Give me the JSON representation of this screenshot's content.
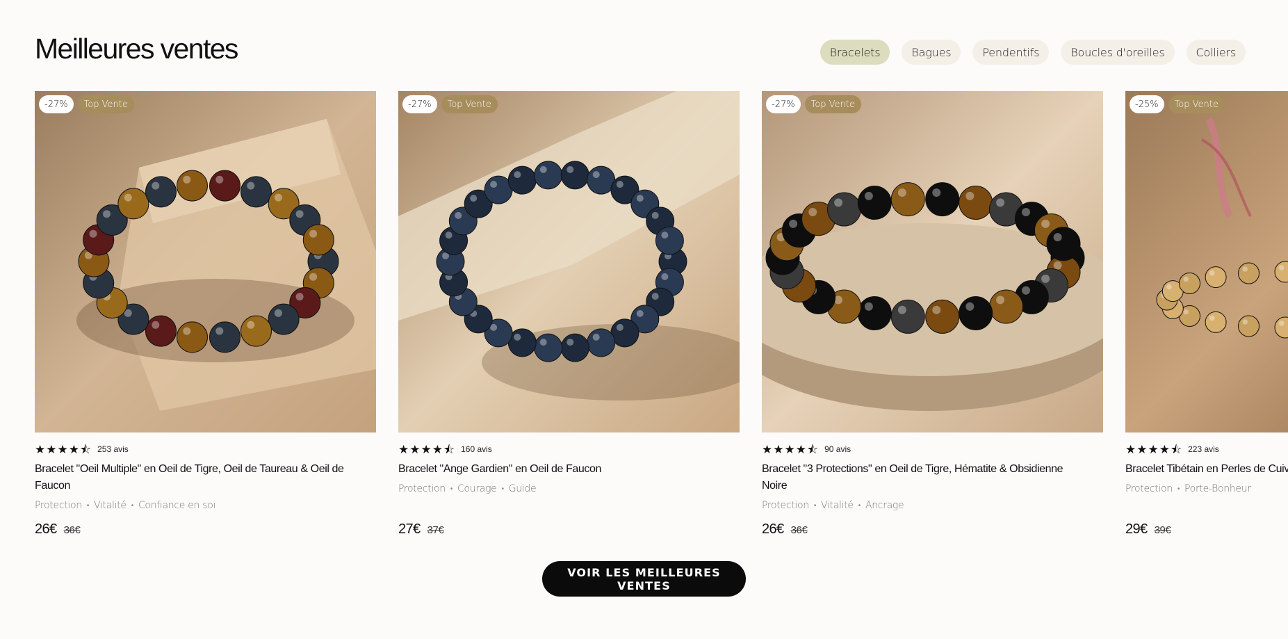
{
  "header": {
    "title": "Meilleures ventes"
  },
  "tabs": [
    {
      "label": "Bracelets",
      "active": true
    },
    {
      "label": "Bagues",
      "active": false
    },
    {
      "label": "Pendentifs",
      "active": false
    },
    {
      "label": "Boucles d'oreilles",
      "active": false
    },
    {
      "label": "Colliers",
      "active": false
    }
  ],
  "products": [
    {
      "discount": "-27%",
      "badge": "Top Vente",
      "rating": 4.5,
      "reviews": "253 avis",
      "name": "Bracelet \"Oeil Multiple\" en Oeil de Tigre, Oeil de Taureau & Oeil de Faucon",
      "tags": [
        "Protection",
        "Vitalité",
        "Confiance en soi"
      ],
      "price": "26€",
      "old_price": "36€"
    },
    {
      "discount": "-27%",
      "badge": "Top Vente",
      "rating": 4.5,
      "reviews": "160 avis",
      "name": "Bracelet \"Ange Gardien\" en Oeil de Faucon",
      "tags": [
        "Protection",
        "Courage",
        "Guide"
      ],
      "price": "27€",
      "old_price": "37€"
    },
    {
      "discount": "-27%",
      "badge": "Top Vente",
      "rating": 4.5,
      "reviews": "90 avis",
      "name": "Bracelet \"3 Protections\" en Oeil de Tigre, Hématite & Obsidienne Noire",
      "tags": [
        "Protection",
        "Vitalité",
        "Ancrage"
      ],
      "price": "26€",
      "old_price": "36€"
    },
    {
      "discount": "-25%",
      "badge": "Top Vente",
      "rating": 4.5,
      "reviews": "223 avis",
      "name": "Bracelet Tibétain en Perles de Cuivre",
      "tags": [
        "Protection",
        "Porte-Bonheur"
      ],
      "price": "29€",
      "old_price": "39€"
    }
  ],
  "cta": {
    "label": "VOIR LES MEILLEURES VENTES"
  },
  "colors": {
    "active_tab": "#dcdcbe",
    "tab": "#f4f0e7",
    "badge_top": "#a78c5c",
    "cta": "#0b0b0b"
  }
}
